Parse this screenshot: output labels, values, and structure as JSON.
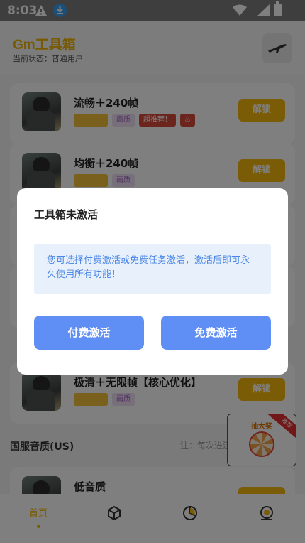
{
  "status_bar": {
    "time": "8:03"
  },
  "header": {
    "title": "Gm工具箱",
    "status_label": "当前状态：普通用户"
  },
  "cards": [
    {
      "name": "流畅＋240帧",
      "tags": [
        "",
        "画质",
        "超推荐！"
      ],
      "unlock": "解锁"
    },
    {
      "name": "均衡＋240帧",
      "tags": [
        "",
        "画质"
      ],
      "unlock": "解锁"
    },
    {
      "name": "极清＋无限帧【核心优化】",
      "tags": [
        "",
        "画质"
      ],
      "unlock": "解锁"
    },
    {
      "name": "低音质",
      "tags": [],
      "unlock": ""
    }
  ],
  "section": {
    "title": "国服音质(US)",
    "note": "注：每次进游"
  },
  "wheel_widget": {
    "title": "抽大奖",
    "ribbon": "推荐"
  },
  "tab_bar": {
    "tabs": [
      {
        "label": "首页",
        "icon": "home-icon"
      },
      {
        "label": "",
        "icon": "cube-icon"
      },
      {
        "label": "",
        "icon": "pie-chart-icon"
      },
      {
        "label": "",
        "icon": "profile-icon"
      }
    ]
  },
  "dialog": {
    "title": "工具箱未激活",
    "message": "您可选择付费激活或免费任务激活，激活后即可永久使用所有功能！",
    "paid_button": "付费激活",
    "free_button": "免费激活"
  },
  "colors": {
    "accent": "#f5b80e",
    "dialog_button": "#5f8ef5",
    "message_bg": "#e7f0fb",
    "message_text": "#4a86e6"
  }
}
